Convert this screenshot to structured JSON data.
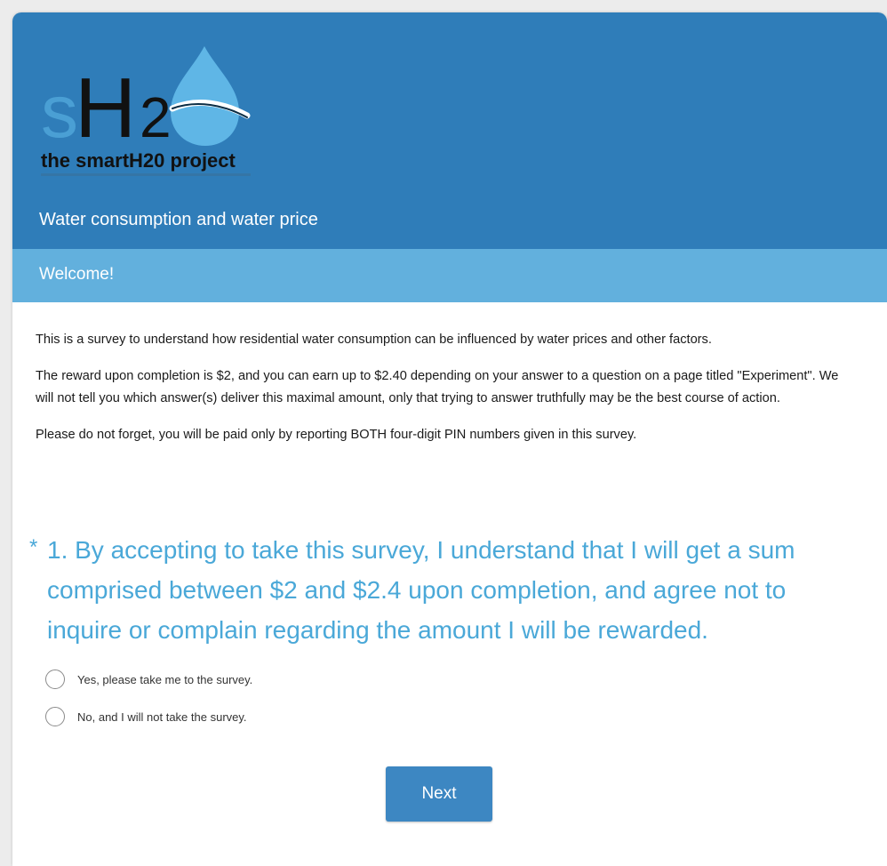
{
  "header": {
    "logo_mark": "sH2",
    "logo_text": "the smartH20 project",
    "logo_subtext": "the smartH2O project",
    "survey_title": "Water consumption and water price",
    "bg_color": "#2f7db9"
  },
  "page": {
    "title": "Welcome!",
    "bar_color": "#62b0dd"
  },
  "intro": {
    "paragraphs": [
      "This is a survey to understand how residential water consumption can be influenced by water prices and other factors.",
      "The reward upon completion is $2, and you can earn up to $2.40 depending on your answer to a question on a page titled \"Experiment\". We will not tell you which answer(s) deliver this maximal amount, only that trying to answer truthfully may be the best course of action.",
      "Please do not forget, you will be paid only by reporting BOTH four-digit PIN numbers given in this survey."
    ]
  },
  "question": {
    "required_marker": "*",
    "text": "1. By accepting to take this survey, I understand that I will get a sum comprised between $2 and $2.4 upon completion, and agree not to inquire or complain regarding the amount I will be rewarded.",
    "color": "#4aa8d8",
    "options": [
      {
        "label": "Yes, please take me to the survey.",
        "selected": false
      },
      {
        "label": "No, and I will not take the survey.",
        "selected": false
      }
    ]
  },
  "actions": {
    "next_label": "Next",
    "next_color": "#3d87c2"
  }
}
